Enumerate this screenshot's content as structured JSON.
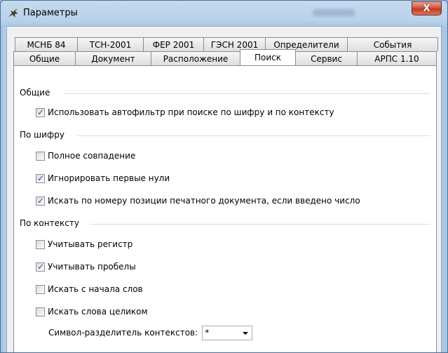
{
  "window": {
    "title": "Параметры",
    "close_label": "X"
  },
  "tabs_back": [
    "МСНБ 84",
    "ТСН-2001",
    "ФЕР 2001",
    "ГЭСН 2001",
    "Определители",
    "События"
  ],
  "tabs_front": [
    "Общие",
    "Документ",
    "Расположение",
    "Поиск",
    "Сервис",
    "АРПС 1.10"
  ],
  "active_tab": "Поиск",
  "groups": {
    "general": {
      "label": "Общие",
      "autofilter": {
        "label": "Использовать автофильтр при поиске по шифру и по контексту",
        "checked": true
      }
    },
    "by_code": {
      "label": "По шифру",
      "exact": {
        "label": "Полное совпадение",
        "checked": false
      },
      "ignore_zeros": {
        "label": "Игнорировать первые нули",
        "checked": true
      },
      "by_position": {
        "label": "Искать по номеру позиции печатного документа, если введено число",
        "checked": true
      }
    },
    "by_context": {
      "label": "По контексту",
      "case": {
        "label": "Учитывать регистр",
        "checked": false
      },
      "spaces": {
        "label": "Учитывать пробелы",
        "checked": true
      },
      "word_start": {
        "label": "Искать с начала слов",
        "checked": false
      },
      "whole_words": {
        "label": "Искать слова целиком",
        "checked": false
      },
      "separator_label": "Символ-разделитель контекстов:",
      "separator_value": "*"
    }
  },
  "colors": {
    "title_bg": "#b9d1ea",
    "close_red": "#c23a20",
    "check_blue": "#1e57a8"
  }
}
